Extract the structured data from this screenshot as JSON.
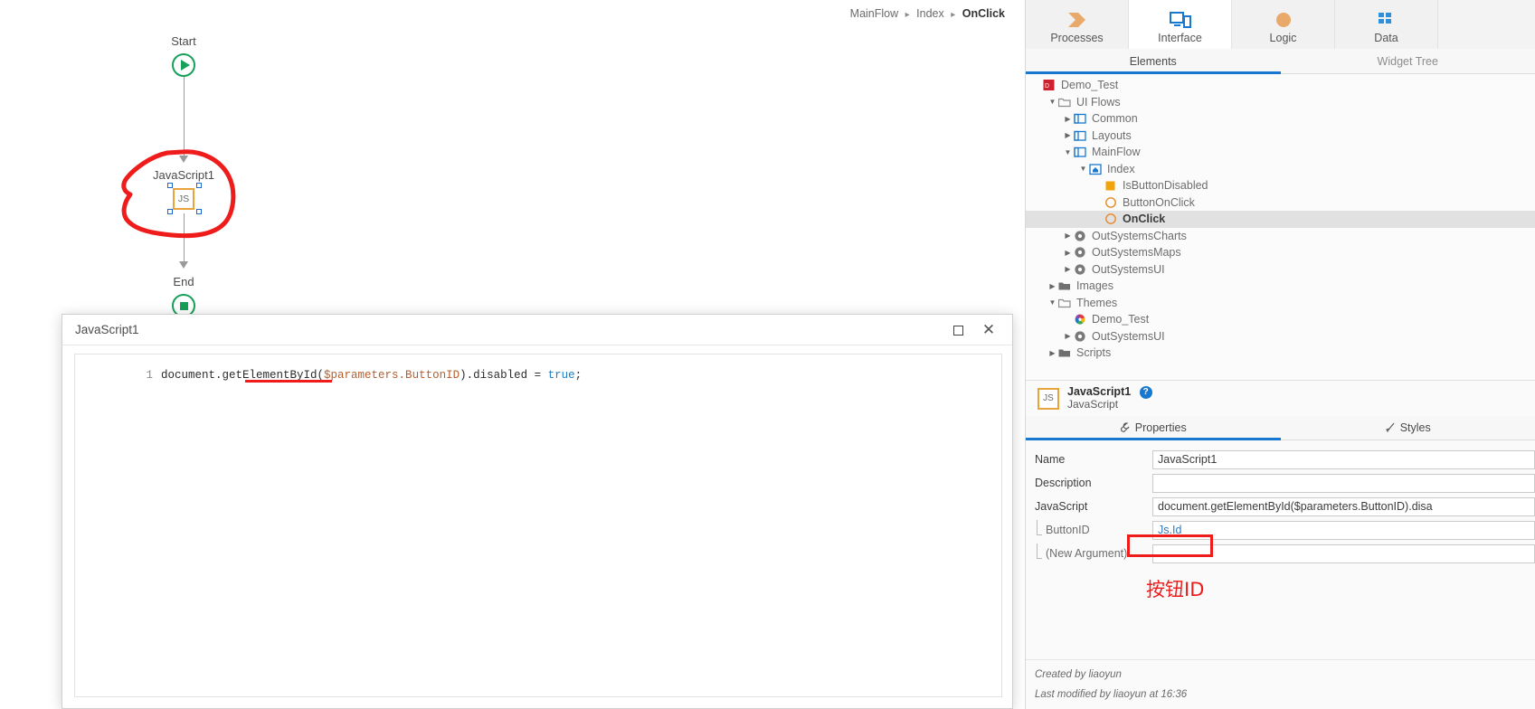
{
  "breadcrumb": {
    "items": [
      "MainFlow",
      "Index",
      "OnClick"
    ],
    "separator": "▸"
  },
  "canvas": {
    "nodes": [
      {
        "label": "Start",
        "icon": "play-circle-icon"
      },
      {
        "label": "JavaScript1",
        "icon": "js-node-icon",
        "icon_text": "JS"
      },
      {
        "label": "End",
        "icon": "stop-circle-icon"
      }
    ],
    "annotation_color": "#ef1c1c"
  },
  "dialog": {
    "title": "JavaScript1",
    "maximize_label": "Maximize",
    "close_label": "✕",
    "code": {
      "line_number": "1",
      "segments": [
        {
          "text": "document.getElementById(",
          "type": "plain"
        },
        {
          "text": "$parameters.ButtonID",
          "type": "param"
        },
        {
          "text": ").disabled = ",
          "type": "plain"
        },
        {
          "text": "true",
          "type": "keyword"
        },
        {
          "text": ";",
          "type": "plain"
        }
      ],
      "full_text": "document.getElementById($parameters.ButtonID).disabled = true;"
    }
  },
  "top_tabs": [
    {
      "label": "Processes",
      "icon": "processes-chevron-icon",
      "active": false
    },
    {
      "label": "Interface",
      "icon": "interface-screen-icon",
      "active": true
    },
    {
      "label": "Logic",
      "icon": "logic-circle-icon",
      "active": false
    },
    {
      "label": "Data",
      "icon": "data-grid-icon",
      "active": false
    }
  ],
  "sub_tabs": [
    {
      "label": "Elements",
      "active": true
    },
    {
      "label": "Widget Tree",
      "active": false
    }
  ],
  "tree": [
    {
      "label": "Demo_Test",
      "depth": 0,
      "twisty": "none",
      "icon": "module-icon",
      "selected": false
    },
    {
      "label": "UI Flows",
      "depth": 1,
      "twisty": "open",
      "icon": "folder-icon",
      "selected": false
    },
    {
      "label": "Common",
      "depth": 2,
      "twisty": "closed",
      "icon": "flow-icon",
      "selected": false
    },
    {
      "label": "Layouts",
      "depth": 2,
      "twisty": "closed",
      "icon": "flow-icon",
      "selected": false
    },
    {
      "label": "MainFlow",
      "depth": 2,
      "twisty": "open",
      "icon": "flow-icon",
      "selected": false
    },
    {
      "label": "Index",
      "depth": 3,
      "twisty": "open",
      "icon": "screen-home-icon",
      "selected": false
    },
    {
      "label": "IsButtonDisabled",
      "depth": 4,
      "twisty": "none",
      "icon": "variable-square-icon",
      "selected": false
    },
    {
      "label": "ButtonOnClick",
      "depth": 4,
      "twisty": "none",
      "icon": "action-circle-icon",
      "selected": false
    },
    {
      "label": "OnClick",
      "depth": 4,
      "twisty": "none",
      "icon": "action-circle-icon",
      "selected": true
    },
    {
      "label": "OutSystemsCharts",
      "depth": 2,
      "twisty": "closed",
      "icon": "dependency-icon",
      "selected": false
    },
    {
      "label": "OutSystemsMaps",
      "depth": 2,
      "twisty": "closed",
      "icon": "dependency-icon",
      "selected": false
    },
    {
      "label": "OutSystemsUI",
      "depth": 2,
      "twisty": "closed",
      "icon": "dependency-icon",
      "selected": false
    },
    {
      "label": "Images",
      "depth": 1,
      "twisty": "closed",
      "icon": "folder-dark-icon",
      "selected": false
    },
    {
      "label": "Themes",
      "depth": 1,
      "twisty": "open",
      "icon": "folder-icon",
      "selected": false
    },
    {
      "label": "Demo_Test",
      "depth": 2,
      "twisty": "none",
      "icon": "theme-icon",
      "selected": false
    },
    {
      "label": "OutSystemsUI",
      "depth": 2,
      "twisty": "closed",
      "icon": "dependency-icon",
      "selected": false
    },
    {
      "label": "Scripts",
      "depth": 1,
      "twisty": "closed",
      "icon": "folder-dark-icon",
      "selected": false
    }
  ],
  "properties": {
    "element_name": "JavaScript1",
    "element_type": "JavaScript",
    "element_badge": "JS",
    "help_label": "?",
    "tabs": [
      {
        "label": "Properties",
        "icon": "wrench-icon",
        "active": true
      },
      {
        "label": "Styles",
        "icon": "brush-icon",
        "active": false
      }
    ],
    "rows": [
      {
        "label": "Name",
        "value": "JavaScript1",
        "child": false,
        "link": false,
        "highlighted": false
      },
      {
        "label": "Description",
        "value": "",
        "child": false,
        "link": false,
        "highlighted": false
      },
      {
        "label": "JavaScript",
        "value": "document.getElementById($parameters.ButtonID).disa",
        "child": false,
        "link": false,
        "highlighted": false
      },
      {
        "label": "ButtonID",
        "value": "Js.Id",
        "child": true,
        "link": true,
        "highlighted": true
      },
      {
        "label": "(New Argument)",
        "value": "",
        "child": true,
        "link": false,
        "highlighted": false
      }
    ],
    "annotation_cn": "按钮ID",
    "footer": {
      "created": "Created by liaoyun",
      "modified": "Last modified by liaoyun at 16:36"
    }
  }
}
